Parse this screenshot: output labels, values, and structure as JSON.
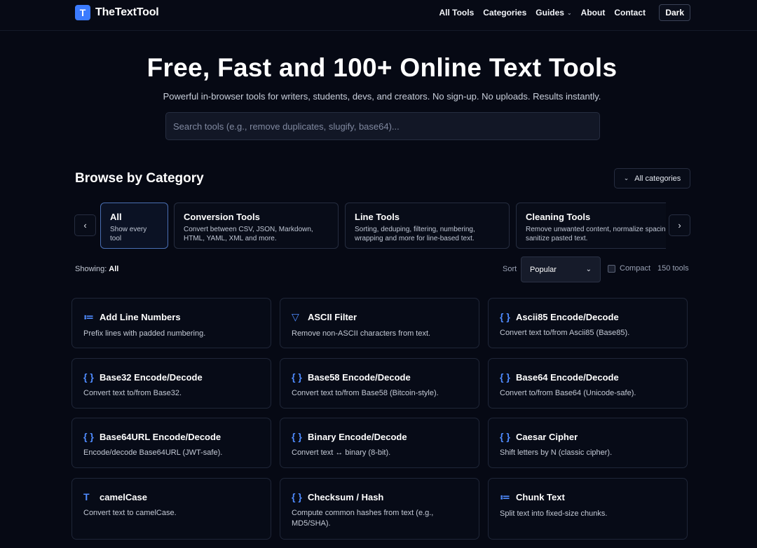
{
  "brand": {
    "logo_letter": "T",
    "name": "TheTextTool"
  },
  "nav": {
    "items": [
      "All Tools",
      "Categories",
      "Guides",
      "About",
      "Contact"
    ],
    "theme_label": "Dark"
  },
  "hero": {
    "title": "Free, Fast and 100+ Online Text Tools",
    "subtitle": "Powerful in-browser tools for writers, students, devs, and creators. No sign-up. No uploads. Results instantly.",
    "search_placeholder": "Search tools (e.g., remove duplicates, slugify, base64)..."
  },
  "browse": {
    "title": "Browse by Category",
    "all_categories_label": "All categories",
    "categories": [
      {
        "title": "All",
        "desc": "Show every tool",
        "active": true
      },
      {
        "title": "Conversion Tools",
        "desc": "Convert between CSV, JSON, Markdown, HTML, YAML, XML and more."
      },
      {
        "title": "Line Tools",
        "desc": "Sorting, deduping, filtering, numbering, wrapping and more for line-based text."
      },
      {
        "title": "Cleaning Tools",
        "desc": "Remove unwanted content, normalize spacing sanitize pasted text."
      }
    ]
  },
  "controls": {
    "showing_label": "Showing:",
    "showing_value": "All",
    "sort_label": "Sort",
    "sort_value": "Popular",
    "compact_label": "Compact",
    "count_label": "150 tools"
  },
  "tools": [
    {
      "icon": "list-numbered-icon",
      "glyph": "≔",
      "name": "Add Line Numbers",
      "desc": "Prefix lines with padded numbering."
    },
    {
      "icon": "filter-icon",
      "glyph": "▽",
      "name": "ASCII Filter",
      "desc": "Remove non-ASCII characters from text."
    },
    {
      "icon": "braces-icon",
      "glyph": "{ }",
      "name": "Ascii85 Encode/Decode",
      "desc": "Convert text to/from Ascii85 (Base85)."
    },
    {
      "icon": "braces-icon",
      "glyph": "{ }",
      "name": "Base32 Encode/Decode",
      "desc": "Convert text to/from Base32."
    },
    {
      "icon": "braces-icon",
      "glyph": "{ }",
      "name": "Base58 Encode/Decode",
      "desc": "Convert text to/from Base58 (Bitcoin-style)."
    },
    {
      "icon": "braces-icon",
      "glyph": "{ }",
      "name": "Base64 Encode/Decode",
      "desc": "Convert to/from Base64 (Unicode-safe)."
    },
    {
      "icon": "braces-icon",
      "glyph": "{ }",
      "name": "Base64URL Encode/Decode",
      "desc": "Encode/decode Base64URL (JWT-safe)."
    },
    {
      "icon": "braces-icon",
      "glyph": "{ }",
      "name": "Binary Encode/Decode",
      "desc": "Convert text ↔ binary (8-bit)."
    },
    {
      "icon": "braces-icon",
      "glyph": "{ }",
      "name": "Caesar Cipher",
      "desc": "Shift letters by N (classic cipher)."
    },
    {
      "icon": "text-icon",
      "glyph": "T",
      "name": "camelCase",
      "desc": "Convert text to camelCase."
    },
    {
      "icon": "braces-icon",
      "glyph": "{ }",
      "name": "Checksum / Hash",
      "desc": "Compute common hashes from text (e.g., MD5/SHA)."
    },
    {
      "icon": "list-icon",
      "glyph": "≔",
      "name": "Chunk Text",
      "desc": "Split text into fixed-size chunks."
    }
  ],
  "colors": {
    "accent": "#3b7bff",
    "icon": "#4f8bff",
    "background": "#060914"
  }
}
